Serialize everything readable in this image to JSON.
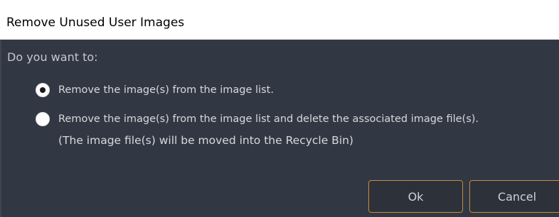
{
  "dialog": {
    "title": "Remove Unused User Images",
    "prompt": "Do you want to:",
    "options": [
      {
        "label": "Remove the image(s) from the image list.",
        "checked": true
      },
      {
        "label": "Remove the image(s) from the image list and delete the associated image file(s).",
        "label_line2": "(The image file(s) will be moved into the Recycle Bin)",
        "checked": false
      }
    ],
    "buttons": {
      "ok": "Ok",
      "cancel": "Cancel"
    }
  },
  "colors": {
    "background": "#323843",
    "button_border": "#c98a3a",
    "text": "#d6d9de"
  }
}
